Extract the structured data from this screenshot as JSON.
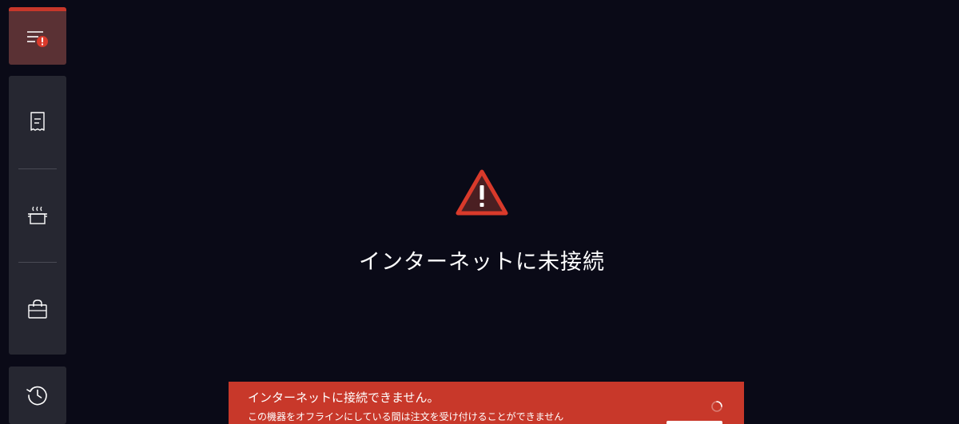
{
  "sidebar": {
    "items": [
      {
        "icon": "order-alert-icon"
      },
      {
        "icon": "receipt-icon"
      },
      {
        "icon": "cooking-pot-icon"
      },
      {
        "icon": "shopping-bag-icon"
      },
      {
        "icon": "history-icon"
      }
    ]
  },
  "main": {
    "title": "インターネットに未接続",
    "icon": "warning-icon"
  },
  "toast": {
    "title": "インターネットに接続できません。",
    "message": "この機器をオフラインにしている間は注文を受け付けることができません",
    "icon": "spinner-icon"
  },
  "colors": {
    "background": "#0a0a17",
    "sidebar": "#262731",
    "active_item": "#5a3134",
    "accent": "#c8372a",
    "toast": "#c8382a"
  }
}
